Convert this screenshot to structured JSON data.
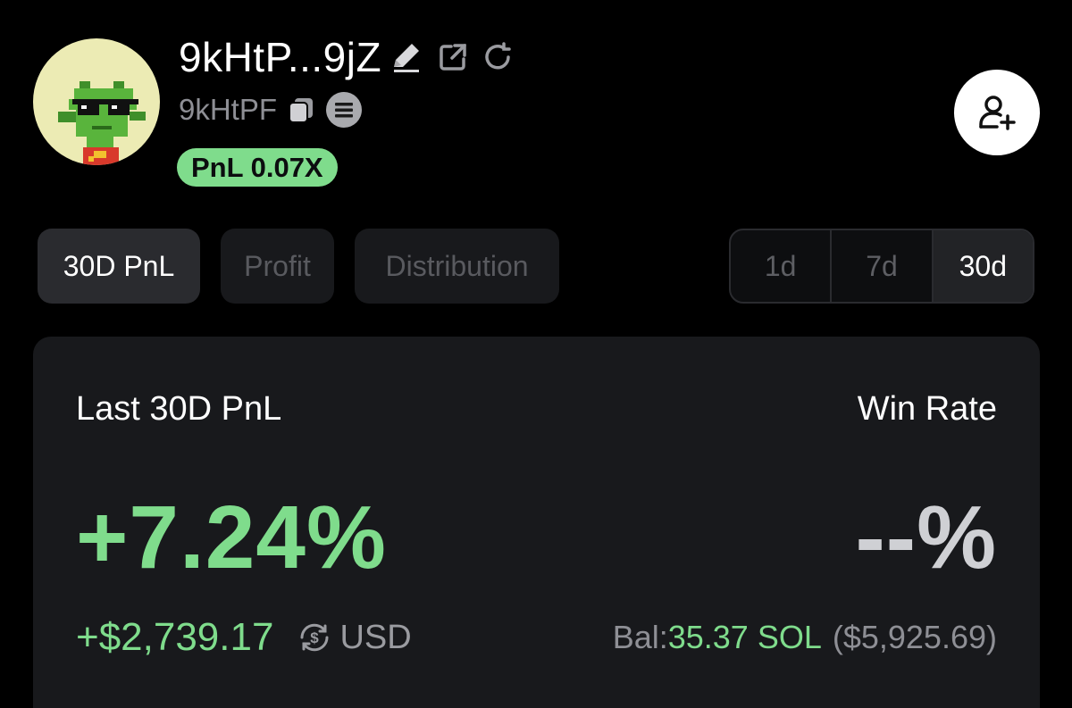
{
  "header": {
    "wallet_name": "9kHtP...9jZ",
    "short_address": "9kHtPF",
    "pnl_badge": "PnL 0.07X",
    "icons": [
      "edit-icon",
      "external-link-icon",
      "refresh-icon",
      "copy-icon",
      "solana-icon",
      "add-user-icon"
    ]
  },
  "tabs": [
    {
      "label": "30D PnL",
      "active": true
    },
    {
      "label": "Profit",
      "active": false
    },
    {
      "label": "Distribution",
      "active": false
    }
  ],
  "periods": [
    {
      "label": "1d",
      "active": false
    },
    {
      "label": "7d",
      "active": false
    },
    {
      "label": "30d",
      "active": true
    }
  ],
  "stats": {
    "pnl_label": "Last 30D PnL",
    "pnl_percent": "+7.24%",
    "pnl_usd": "+$2,739.17",
    "currency": "USD",
    "winrate_label": "Win Rate",
    "winrate_value": "--%",
    "balance_label": "Bal:",
    "balance_sol": "35.37 SOL",
    "balance_usd": "($5,925.69)"
  },
  "colors": {
    "background": "#000000",
    "card": "#18191c",
    "positive": "#7fdc8c",
    "muted": "#8e8f95"
  }
}
